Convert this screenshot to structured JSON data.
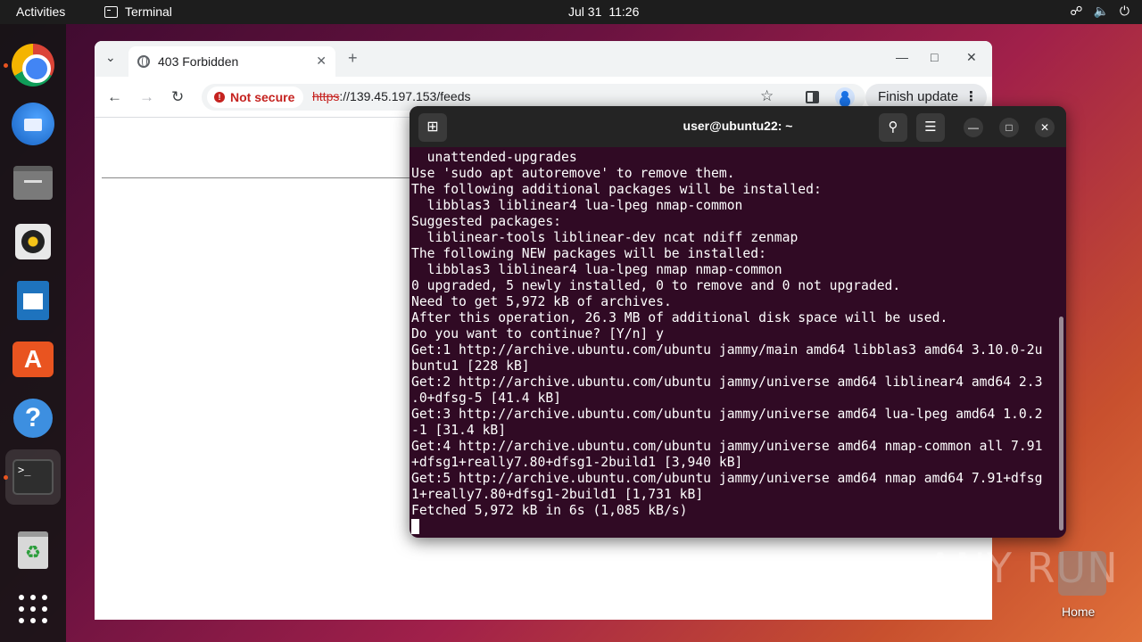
{
  "topbar": {
    "activities": "Activities",
    "app_name": "Terminal",
    "date": "Jul 31",
    "time": "11:26",
    "tray_icons": [
      "network-icon",
      "volume-icon",
      "power-icon"
    ]
  },
  "dock": {
    "items": [
      "google-chrome",
      "thunderbird",
      "files",
      "rhythmbox",
      "libreoffice-writer",
      "ubuntu-software",
      "help",
      "terminal",
      "trash",
      "show-applications"
    ]
  },
  "browser": {
    "tab_title": "403 Forbidden",
    "security_label": "Not secure",
    "url_scheme": "https",
    "url_rest": "://139.45.197.153/feeds",
    "update_button": "Finish update"
  },
  "terminal": {
    "title": "user@ubuntu22: ~",
    "lines": [
      "  unattended-upgrades",
      "Use 'sudo apt autoremove' to remove them.",
      "The following additional packages will be installed:",
      "  libblas3 liblinear4 lua-lpeg nmap-common",
      "Suggested packages:",
      "  liblinear-tools liblinear-dev ncat ndiff zenmap",
      "The following NEW packages will be installed:",
      "  libblas3 liblinear4 lua-lpeg nmap nmap-common",
      "0 upgraded, 5 newly installed, 0 to remove and 0 not upgraded.",
      "Need to get 5,972 kB of archives.",
      "After this operation, 26.3 MB of additional disk space will be used.",
      "Do you want to continue? [Y/n] y",
      "Get:1 http://archive.ubuntu.com/ubuntu jammy/main amd64 libblas3 amd64 3.10.0-2u",
      "buntu1 [228 kB]",
      "Get:2 http://archive.ubuntu.com/ubuntu jammy/universe amd64 liblinear4 amd64 2.3",
      ".0+dfsg-5 [41.4 kB]",
      "Get:3 http://archive.ubuntu.com/ubuntu jammy/universe amd64 lua-lpeg amd64 1.0.2",
      "-1 [31.4 kB]",
      "Get:4 http://archive.ubuntu.com/ubuntu jammy/universe amd64 nmap-common all 7.91",
      "+dfsg1+really7.80+dfsg1-2build1 [3,940 kB]",
      "Get:5 http://archive.ubuntu.com/ubuntu jammy/universe amd64 nmap amd64 7.91+dfsg",
      "1+really7.80+dfsg1-2build1 [1,731 kB]",
      "Fetched 5,972 kB in 6s (1,085 kB/s)"
    ]
  },
  "desktop": {
    "watermark": "ANY RUN",
    "home_label": "Home"
  }
}
